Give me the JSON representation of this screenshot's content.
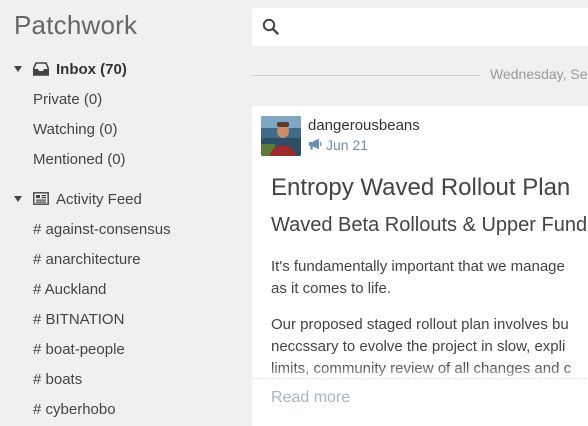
{
  "app": {
    "title": "Patchwork"
  },
  "sidebar": {
    "inbox": {
      "label": "Inbox (70)"
    },
    "inbox_items": [
      {
        "label": "Private (0)"
      },
      {
        "label": "Watching (0)"
      },
      {
        "label": "Mentioned (0)"
      }
    ],
    "feed": {
      "label": "Activity Feed"
    },
    "channels": [
      {
        "label": "# against-consensus"
      },
      {
        "label": "# anarchitecture"
      },
      {
        "label": "# Auckland"
      },
      {
        "label": "# BITNATION"
      },
      {
        "label": "# boat-people"
      },
      {
        "label": "# boats"
      },
      {
        "label": "# cyberhobo"
      }
    ]
  },
  "search": {
    "value": "",
    "placeholder": ""
  },
  "feed_divider": {
    "date": "Wednesday, Se"
  },
  "post": {
    "author": "dangerousbeans",
    "date": "Jun 21",
    "title": "Entropy Waved Rollout Plan",
    "subtitle": "Waved Beta Rollouts & Upper Fund",
    "paragraph1": [
      "It's fundamentally important that we manage",
      "as it comes to life."
    ],
    "paragraph2": [
      "Our proposed staged rollout plan involves bu",
      "neccssary to evolve the project in slow, expli",
      "limits, community review of all changes and c"
    ],
    "read_more": "Read more"
  },
  "colors": {
    "background": "#f0f0f0",
    "card": "#ffffff",
    "link_blue": "#6a8db3",
    "muted": "#999999"
  },
  "icons": {
    "inbox": "inbox-tray-icon",
    "feed": "newspaper-icon",
    "search": "magnifier-icon",
    "post_type": "megaphone-icon"
  }
}
